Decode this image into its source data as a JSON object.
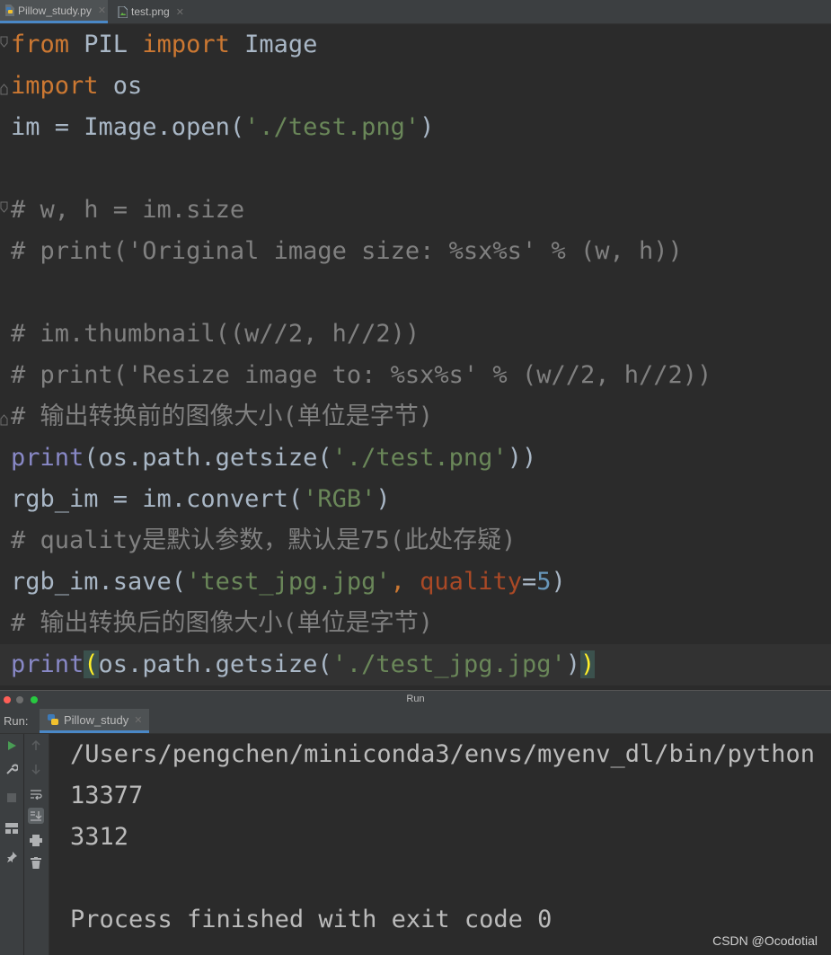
{
  "tabs": [
    {
      "label": "Pillow_study.py",
      "icon": "python-file-icon",
      "active": true
    },
    {
      "label": "test.png",
      "icon": "image-file-icon",
      "active": false
    }
  ],
  "editor": {
    "lines": [
      [
        {
          "t": "from",
          "c": "kw"
        },
        {
          "t": " PIL ",
          "c": ""
        },
        {
          "t": "import",
          "c": "kw"
        },
        {
          "t": " Image",
          "c": ""
        }
      ],
      [
        {
          "t": "import",
          "c": "kw"
        },
        {
          "t": " os",
          "c": ""
        }
      ],
      [
        {
          "t": "im = Image.open(",
          "c": ""
        },
        {
          "t": "'./test.png'",
          "c": "str"
        },
        {
          "t": ")",
          "c": ""
        }
      ],
      [],
      [
        {
          "t": "# w, h = im.size",
          "c": "cmt"
        }
      ],
      [
        {
          "t": "# print('Original image size: %sx%s' % (w, h))",
          "c": "cmt"
        }
      ],
      [],
      [
        {
          "t": "# im.thumbnail((w//2, h//2))",
          "c": "cmt"
        }
      ],
      [
        {
          "t": "# print('Resize image to: %sx%s' % (w//2, h//2))",
          "c": "cmt"
        }
      ],
      [
        {
          "t": "# 输出转换前的图像大小(单位是字节)",
          "c": "cmt"
        }
      ],
      [
        {
          "t": "print",
          "c": "builtin"
        },
        {
          "t": "(os.path.getsize(",
          "c": ""
        },
        {
          "t": "'./test.png'",
          "c": "str"
        },
        {
          "t": "))",
          "c": ""
        }
      ],
      [
        {
          "t": "rgb_im = im.convert(",
          "c": ""
        },
        {
          "t": "'RGB'",
          "c": "str"
        },
        {
          "t": ")",
          "c": ""
        }
      ],
      [
        {
          "t": "# quality是默认参数，默认是75(此处存疑)",
          "c": "cmt"
        }
      ],
      [
        {
          "t": "rgb_im.save(",
          "c": ""
        },
        {
          "t": "'test_jpg.jpg'",
          "c": "str"
        },
        {
          "t": ", ",
          "c": "kw"
        },
        {
          "t": "quality",
          "c": "param"
        },
        {
          "t": "=",
          "c": ""
        },
        {
          "t": "5",
          "c": "num"
        },
        {
          "t": ")",
          "c": ""
        }
      ],
      [
        {
          "t": "# 输出转换后的图像大小(单位是字节)",
          "c": "cmt"
        }
      ],
      [
        {
          "t": "print",
          "c": "builtin"
        },
        {
          "t": "(",
          "c": "brace"
        },
        {
          "t": "os.path.getsize(",
          "c": ""
        },
        {
          "t": "'./test_jpg.jpg'",
          "c": "str"
        },
        {
          "t": ")",
          "c": ""
        },
        {
          "t": ")",
          "c": "brace"
        }
      ]
    ]
  },
  "run_window": {
    "title": "Run",
    "label": "Run:",
    "tab": "Pillow_study",
    "output": [
      "/Users/pengchen/miniconda3/envs/myenv_dl/bin/python",
      "13377",
      "3312",
      "",
      "Process finished with exit code 0"
    ]
  },
  "colors": {
    "keyword": "#cc7832",
    "string": "#6a8759",
    "comment": "#808080",
    "builtin": "#8888c6",
    "param": "#aa4926",
    "number": "#6897bb",
    "close_dot": "#ff5f57",
    "min_dot": "#6e6e6e",
    "max_dot": "#28c940"
  },
  "watermark": "CSDN @Ocodotial"
}
